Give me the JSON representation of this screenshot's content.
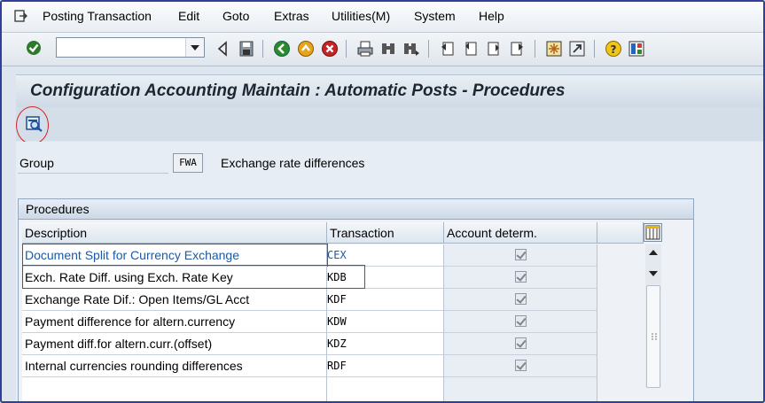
{
  "menubar": {
    "items": [
      "Posting Transaction",
      "Edit",
      "Goto",
      "Extras",
      "Utilities(M)",
      "System",
      "Help"
    ]
  },
  "toolbar": {
    "command_field_value": "",
    "icons": [
      "enter-icon",
      "back-arrow-icon",
      "save-icon",
      "back-icon",
      "exit-icon",
      "cancel-icon",
      "print-icon",
      "find-icon",
      "find-next-icon",
      "first-page-icon",
      "previous-page-icon",
      "next-page-icon",
      "last-page-icon",
      "create-session-icon",
      "shortcut-icon",
      "help-icon",
      "layout-menu-icon"
    ]
  },
  "title": "Configuration Accounting Maintain : Automatic Posts - Procedures",
  "appbar": {
    "icons": [
      "detail-view-icon"
    ]
  },
  "group": {
    "label": "Group",
    "value": "FWA",
    "description": "Exchange rate differences"
  },
  "procedures": {
    "title": "Procedures",
    "columns": [
      "Description",
      "Transaction",
      "Account determ."
    ],
    "rows": [
      {
        "description": "Document Split for Currency Exchange",
        "transaction": "CEX",
        "account_determ": true,
        "highlight_color": "#1b5aa6"
      },
      {
        "description": "Exch. Rate Diff. using Exch. Rate Key",
        "transaction": "KDB",
        "account_determ": true
      },
      {
        "description": "Exchange Rate Dif.: Open Items/GL Acct",
        "transaction": "KDF",
        "account_determ": true
      },
      {
        "description": "Payment difference for altern.currency",
        "transaction": "KDW",
        "account_determ": true
      },
      {
        "description": "Payment diff.for altern.curr.(offset)",
        "transaction": "KDZ",
        "account_determ": true
      },
      {
        "description": "Internal currencies rounding differences",
        "transaction": "RDF",
        "account_determ": true
      }
    ]
  },
  "annotation_color": "#d91f26"
}
